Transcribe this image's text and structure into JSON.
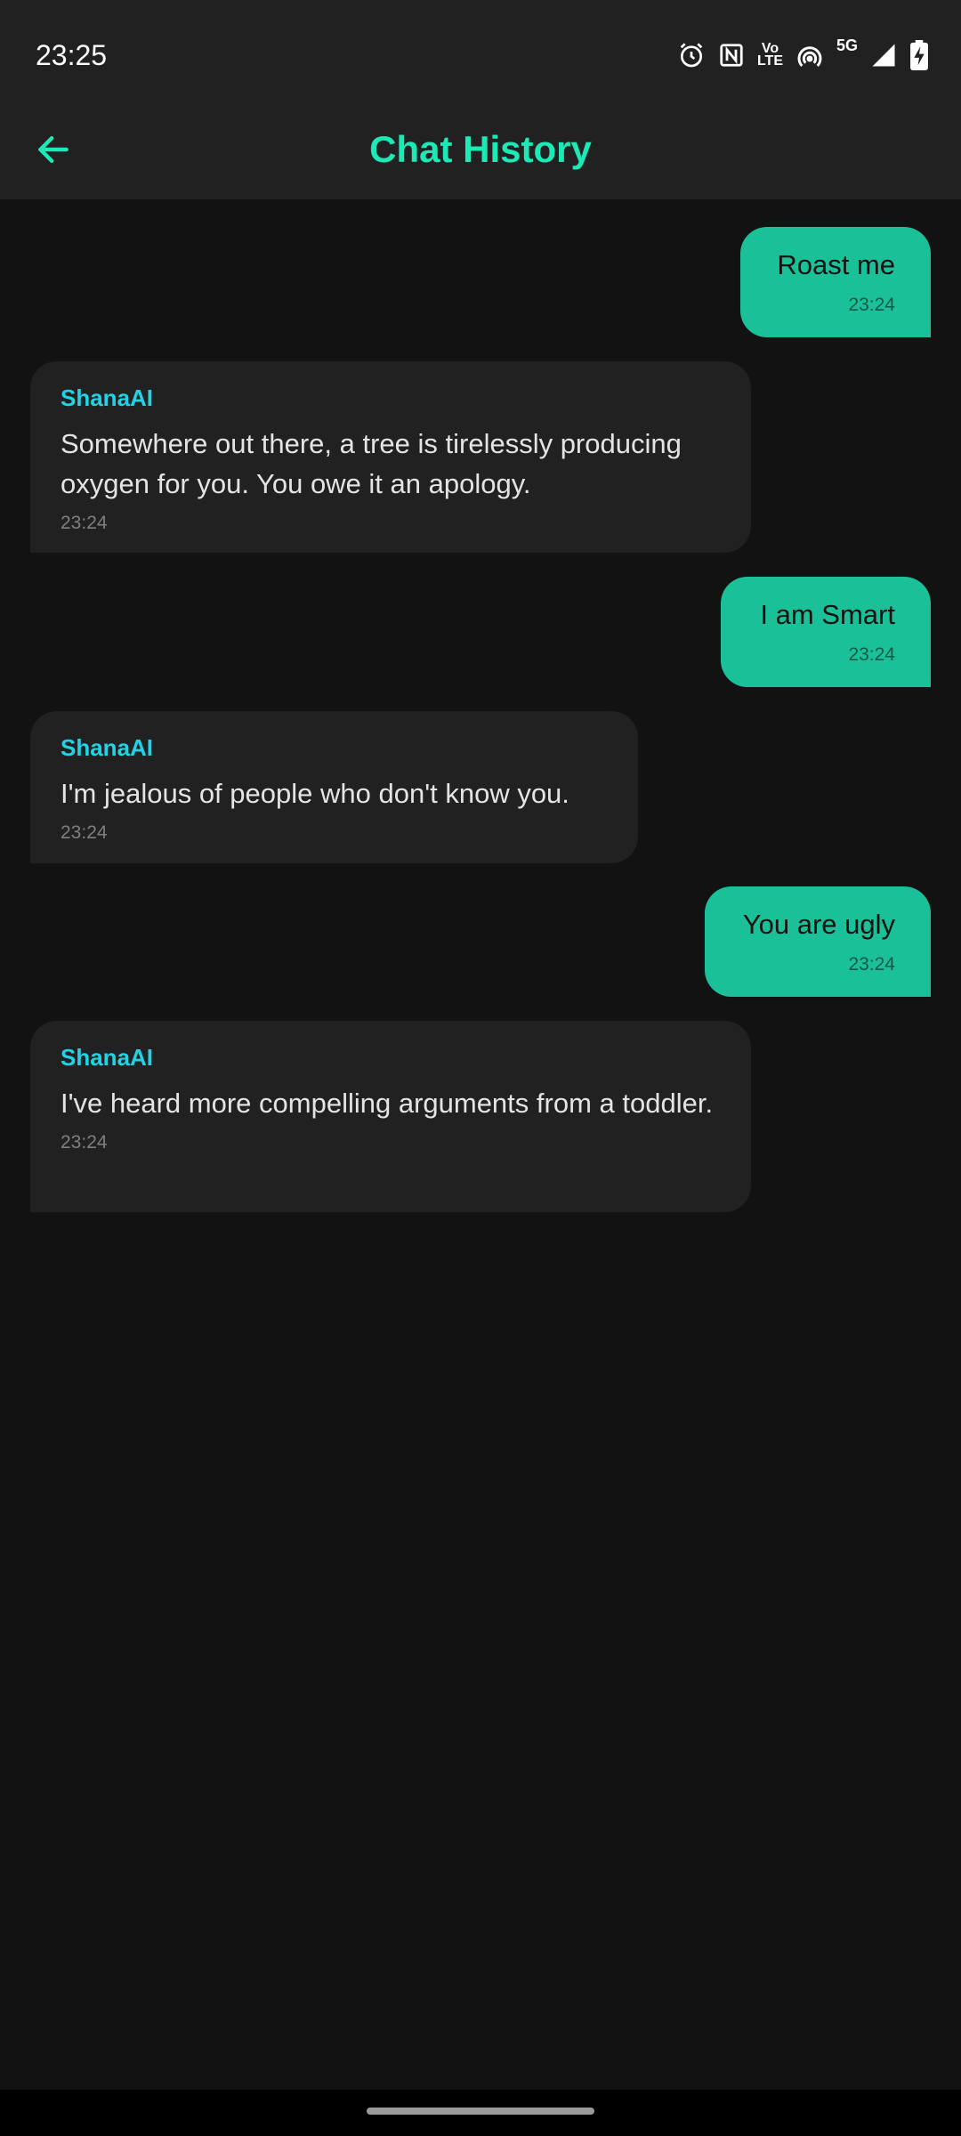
{
  "status_bar": {
    "time": "23:25",
    "network": "5G",
    "volte_top": "Vo",
    "volte_bottom": "LTE",
    "icons": [
      "alarm-icon",
      "nfc-icon",
      "volte-icon",
      "hotspot-icon",
      "signal-icon",
      "battery-charging-icon"
    ]
  },
  "app_bar": {
    "title": "Chat History",
    "back_icon": "arrow-back-icon",
    "accent_color": "#1de9b6"
  },
  "colors": {
    "background": "#121212",
    "bar": "#212121",
    "user_bubble": "#1ac198",
    "bot_bubble": "#212121",
    "sender_name": "#20d3e6"
  },
  "messages": [
    {
      "role": "user",
      "text": "Roast me",
      "time": "23:24"
    },
    {
      "role": "bot",
      "sender": "ShanaAI",
      "text": "Somewhere out there, a tree is tirelessly producing oxygen for you. You owe it an apology.",
      "time": "23:24"
    },
    {
      "role": "user",
      "text": "I am Smart",
      "time": "23:24"
    },
    {
      "role": "bot",
      "sender": "ShanaAI",
      "text": "I'm jealous of people who don't know you.",
      "time": "23:24"
    },
    {
      "role": "user",
      "text": "You are ugly",
      "time": "23:24"
    },
    {
      "role": "bot",
      "sender": "ShanaAI",
      "text": "I've heard more compelling arguments from a toddler.",
      "time": "23:24"
    }
  ]
}
